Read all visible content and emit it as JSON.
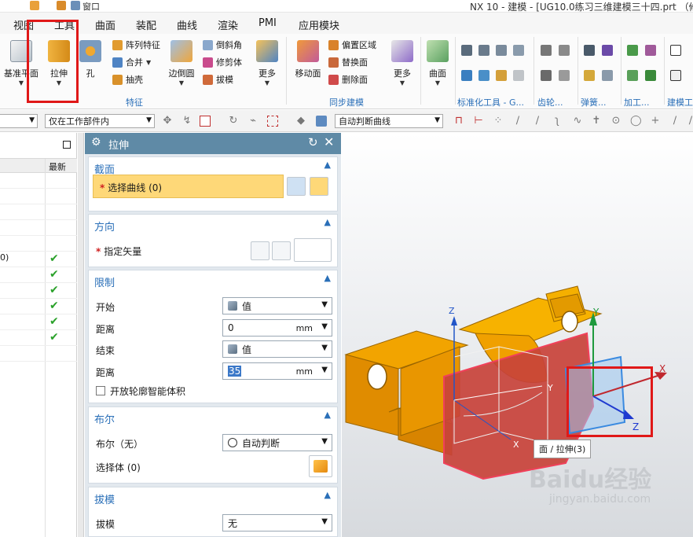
{
  "titlebar": {
    "window_menu": "窗口",
    "title": "NX 10 - 建模 - [UG10.0练习三维建模三十四.prt （修"
  },
  "menu_tabs": [
    "视图",
    "工具",
    "曲面",
    "装配",
    "曲线",
    "渲染",
    "PMI",
    "应用模块"
  ],
  "ribbon": {
    "datum_plane": "基准平面",
    "extrude": "拉伸",
    "hole": "孔",
    "pattern_feature": "阵列特征",
    "unite": "合并",
    "shell": "抽壳",
    "edge_blend": "边倒圆",
    "chamfer": "倒斜角",
    "trim_body": "修剪体",
    "draft": "拔模",
    "more_1": "更多",
    "move_face": "移动面",
    "offset_region": "偏置区域",
    "replace_face": "替换面",
    "delete_face": "删除面",
    "more_2": "更多",
    "surface": "曲面",
    "group_feature": "特征",
    "group_sync": "同步建模",
    "group_std": "标准化工具 - G...",
    "group_gear": "齿轮...",
    "group_spring": "弹簧...",
    "group_tool": "加工...",
    "group_build": "建模工"
  },
  "toolbar": {
    "filter_value": "",
    "scope_value": "仅在工作部件内",
    "curve_rule": "自动判断曲线"
  },
  "navigator": {
    "latest_header": "最新",
    "partial_text": "0)"
  },
  "dialog": {
    "title": "拉伸",
    "section": {
      "header": "截面",
      "select_curve": "选择曲线 (0)"
    },
    "direction": {
      "header": "方向",
      "specify_vector": "指定矢量"
    },
    "limits": {
      "header": "限制",
      "start_label": "开始",
      "start_value": "值",
      "distance1_label": "距离",
      "distance1_value": "0",
      "distance1_unit": "mm",
      "end_label": "结束",
      "end_value": "值",
      "distance2_label": "距离",
      "distance2_value": "35",
      "distance2_unit": "mm",
      "open_profile": "开放轮廓智能体积"
    },
    "boolean": {
      "header": "布尔",
      "boolean_label": "布尔（无）",
      "boolean_value": "自动判断",
      "select_body": "选择体 (0)"
    },
    "draft": {
      "header": "拔模",
      "draft_label": "拔模",
      "draft_value": "无"
    }
  },
  "viewport": {
    "tooltip": "面 / 拉伸(3)",
    "axis_x": "X",
    "axis_y": "Y",
    "axis_z": "Z",
    "watermark": "Baidu经验",
    "watermark_sub": "jingyan.baidu.com"
  },
  "colors": {
    "accent": "#2a6fb8",
    "dialog_header": "#5f8aa6",
    "highlight_field": "#fed878",
    "part_orange": "#f5a800",
    "part_red_face": "#c8423a",
    "highlight_red": "#e01818",
    "check_green": "#2aa12a"
  }
}
